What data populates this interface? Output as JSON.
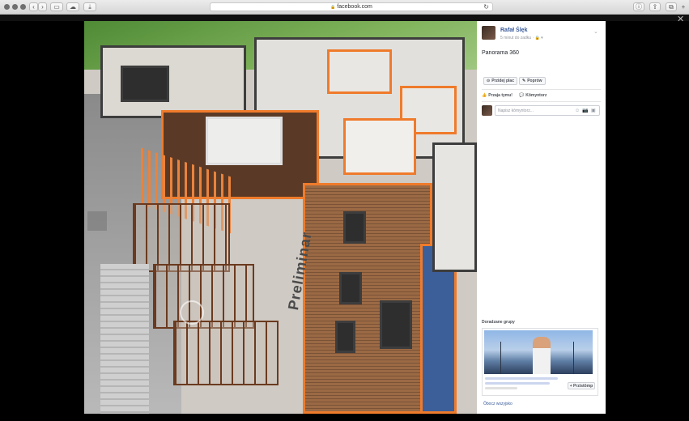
{
  "browser": {
    "url": "facebook.com",
    "lock_glyph": "🔒",
    "buttons": {
      "back": "‹",
      "forward": "›",
      "sidebar": "▭",
      "cloud": "☁",
      "download": "⤓",
      "reload": "↻",
      "shield": "ⓘ",
      "share": "⇪",
      "tabs": "⧉",
      "add": "+"
    }
  },
  "overlay": {
    "close": "✕"
  },
  "viewer": {
    "sign_text": "Preliminar"
  },
  "post": {
    "author": "Rafał Ślęk",
    "time": "5 minut do zadku · ",
    "privacy": "🔒 ▾",
    "menu": "⌄",
    "text": "Panorama 360",
    "buttons": {
      "location_icon": "⊙",
      "location": "Przidej plac",
      "edit_icon": "✎",
      "edit": "Poprów"
    },
    "actions": {
      "like_icon": "👍",
      "like": "Przaja tymu!",
      "comment_icon": "💬",
      "comment": "Kōmyntorz"
    },
    "comment_placeholder": "Napisz kōmyntorz...",
    "comment_icons": [
      "☺",
      "📷",
      "▣"
    ]
  },
  "suggestions": {
    "title": "Doradzane grupy",
    "join_label": "+ Przistōmp",
    "see_all": "Ôbocz wszyjsko"
  },
  "colors": {
    "accent": "#365899",
    "orange_outline": "#ef7b2b"
  }
}
